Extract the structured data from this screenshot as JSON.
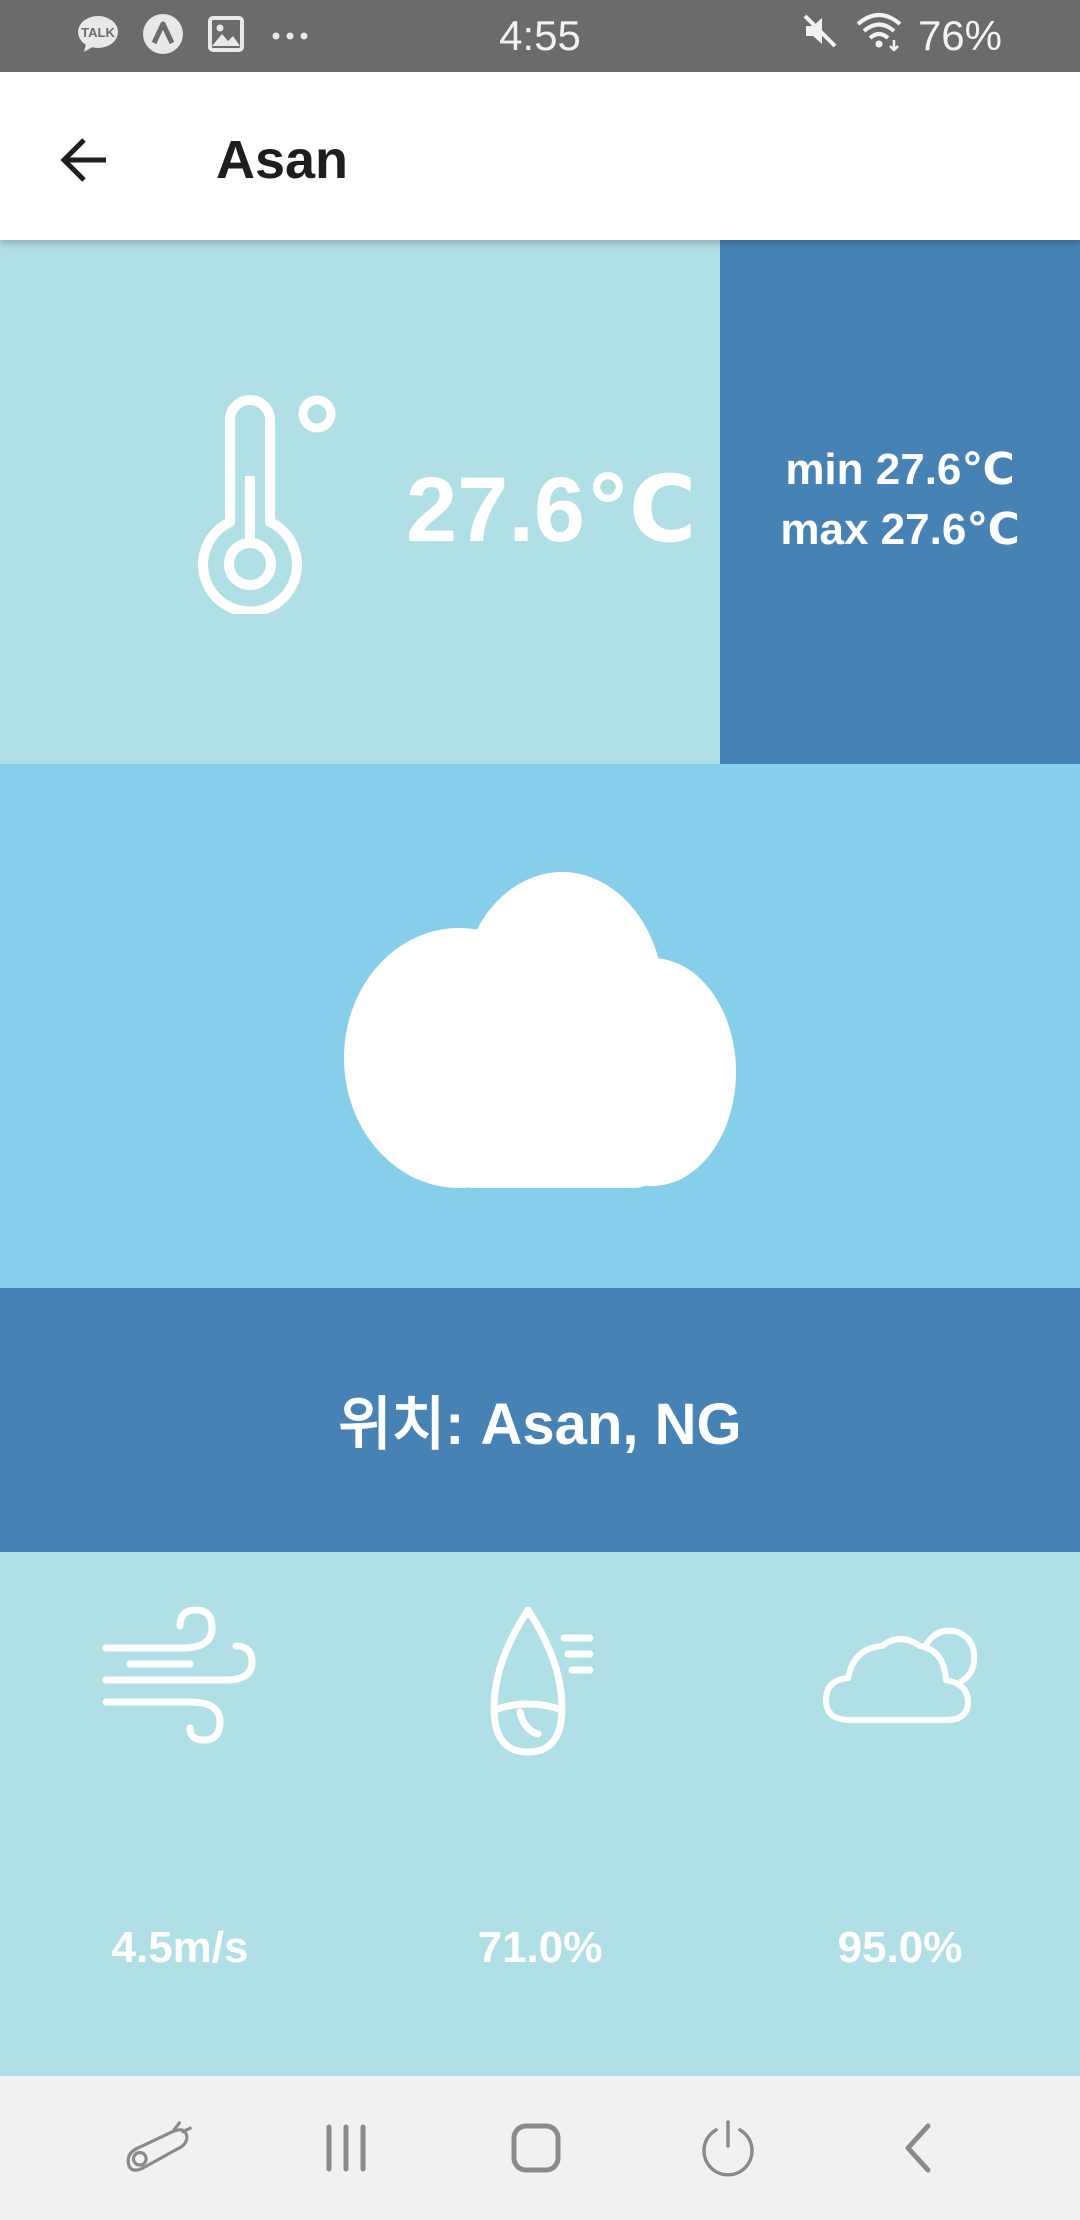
{
  "status_bar": {
    "time": "4:55",
    "battery": "76%",
    "left_icons": [
      "kakaotalk-icon",
      "naver-icon",
      "gallery-icon",
      "more-dots-icon"
    ],
    "kakao_label": "TALK",
    "right_icons": [
      "mute-icon",
      "wifi-icon"
    ]
  },
  "app_bar": {
    "title": "Asan",
    "back_icon": "arrow-left-icon"
  },
  "temperature": {
    "current": "27.6℃",
    "min": "min 27.6℃",
    "max": "max 27.6℃",
    "icon": "thermometer-icon"
  },
  "condition": {
    "icon": "cloud-icon"
  },
  "location": {
    "text": "위치: Asan, NG"
  },
  "metrics": [
    {
      "icon": "wind-icon",
      "value": "4.5m/s"
    },
    {
      "icon": "humidity-icon",
      "value": "71.0%"
    },
    {
      "icon": "cloudiness-icon",
      "value": "95.0%"
    }
  ],
  "nav_bar": {
    "items": [
      "assistant-icon",
      "recent-apps-icon",
      "home-icon",
      "power-icon",
      "back-icon"
    ]
  },
  "colors": {
    "status_bar": "#6B6B6B",
    "light_panel": "#B0DFE6",
    "dark_panel": "#4682B4",
    "sky_panel": "#87CEEB",
    "nav_bar": "#F1F1F1"
  }
}
